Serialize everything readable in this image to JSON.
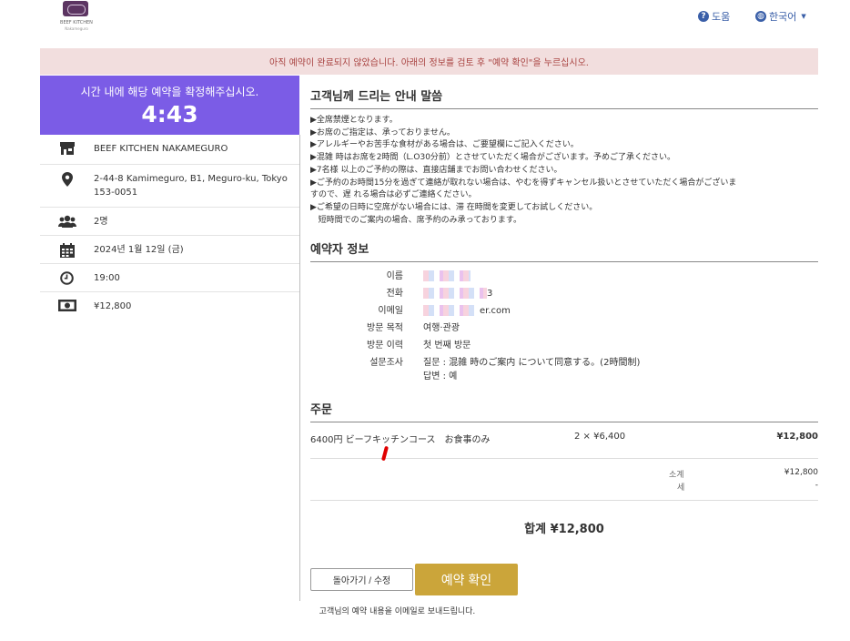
{
  "header": {
    "logo_text": "BEEF KITCHEN",
    "logo_sub": "Nakameguro",
    "help_label": "도움",
    "lang_label": "한국어"
  },
  "alert": "아직 예약이 완료되지 않았습니다. 아래의 정보를 검토 후 \"예약 확인\"을 누르십시오.",
  "sidebar": {
    "timer_label": "시간 내에 해당 예약을 확정해주십시오.",
    "timer_value": "4:43",
    "items": [
      {
        "icon": "store-icon",
        "text": "BEEF KITCHEN NAKAMEGURO"
      },
      {
        "icon": "map-pin-icon",
        "text": "2-44-8 Kamimeguro, B1, Meguro-ku, Tokyo 153-0051"
      },
      {
        "icon": "people-icon",
        "text": "2명"
      },
      {
        "icon": "calendar-icon",
        "text": "2024년 1월 12일 (금)"
      },
      {
        "icon": "clock-icon",
        "text": "19:00"
      },
      {
        "icon": "money-icon",
        "text": "¥12,800"
      }
    ]
  },
  "notice": {
    "title": "고객님께 드리는 안내 말씀",
    "lines": [
      "▶全席禁煙となります。",
      "▶お席のご指定は、承っておりません。",
      "▶アレルギーやお苦手な食材がある場合は、ご要望欄にご記入ください。",
      "▶混雑 時はお席を2時間（L.O30分前）とさせていただく場合がございます。予めご了承ください。",
      "▶7名様 以上のご予約の際は、直接店舗までお問い合わせください。",
      "▶ご予約のお時間15分を過ぎて連絡が取れない場合は、やむを得ずキャンセル扱いとさせていただく場合がございま",
      "すので、遅 れる場合は必ずご連絡ください。",
      "▶ご希望の日時に空席がない場合には、滞 在時間を変更してお試しください。",
      "   短時間でのご案内の場合、席予約のみ承っております。"
    ]
  },
  "reservation": {
    "title": "예약자 정보",
    "name_label": "이름",
    "phone_label": "전화",
    "phone_suffix": "3",
    "email_label": "이메일",
    "email_suffix": "er.com",
    "purpose_label": "방문 목적",
    "purpose_value": "여행·관광",
    "history_label": "방문 이력",
    "history_value": "첫 번째 방문",
    "survey_label": "설문조사",
    "survey_q": "질문 : 混雑 時のご案内 について同意する。(2時間制)",
    "survey_a": "답변 : 예"
  },
  "order": {
    "title": "주문",
    "item_name": "6400円 ビーフキッチンコース　お食事のみ",
    "item_qty": "2 × ¥6,400",
    "item_price": "¥12,800",
    "subtotal_label": "소계",
    "subtotal_value": "¥12,800",
    "tax_label": "세",
    "tax_value": "-",
    "total": "합계 ¥12,800"
  },
  "buttons": {
    "back": "돌아가기 / 수정",
    "confirm": "예약 확인"
  },
  "footer": "고객님의 예약 내용을 이메일로 보내드립니다."
}
